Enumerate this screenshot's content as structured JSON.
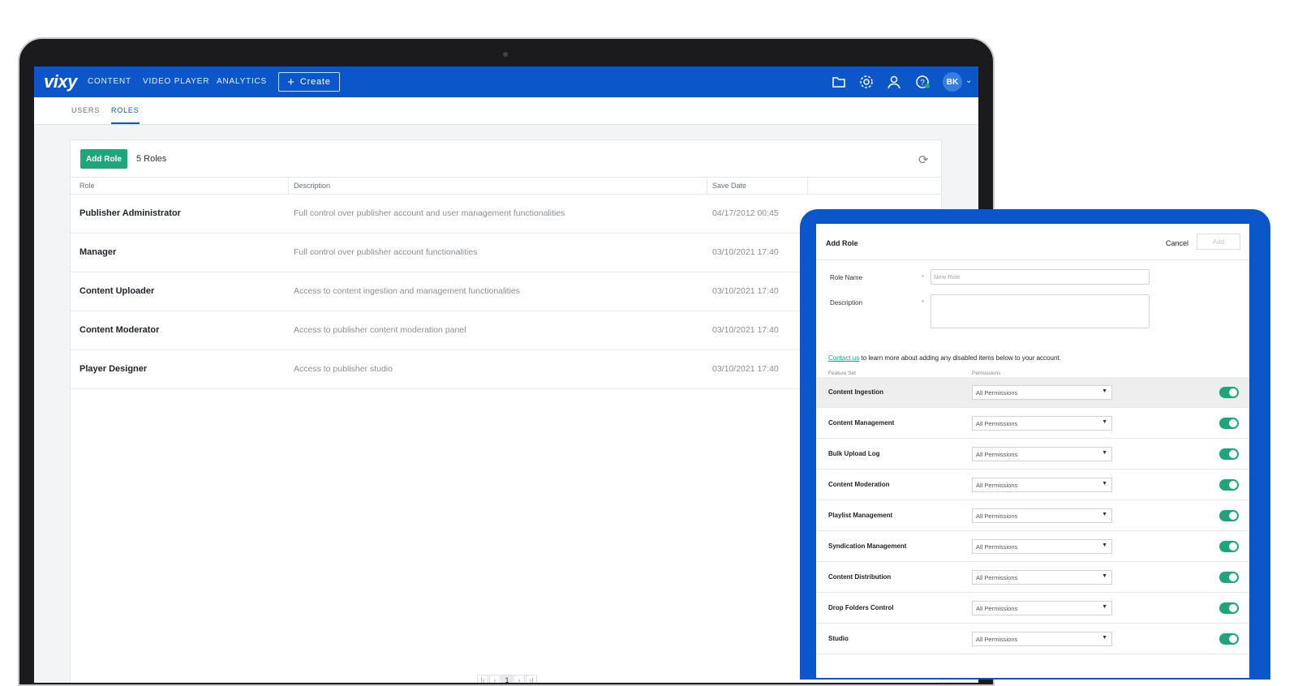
{
  "app": {
    "logo": "vixy",
    "nav": [
      "CONTENT",
      "VIDEO PLAYER",
      "ANALYTICS"
    ],
    "create_label": "Create",
    "avatar_initials": "BK",
    "icons": [
      "folder-icon",
      "gear-icon",
      "user-icon",
      "help-icon"
    ],
    "accent": "#0b56c9",
    "success": "#1ea57a"
  },
  "subtabs": [
    "USERS",
    "ROLES"
  ],
  "roles_panel": {
    "add_role_label": "Add Role",
    "count_label": "5 Roles",
    "columns": [
      "Role",
      "Description",
      "Save Date"
    ],
    "rows": [
      {
        "name": "Publisher Administrator",
        "description": "Full control over publisher account and user management functionalities",
        "date": "04/17/2012 00:45"
      },
      {
        "name": "Manager",
        "description": "Full control over publisher account functionalities",
        "date": "03/10/2021 17:40"
      },
      {
        "name": "Content Uploader",
        "description": "Access to content ingestion and management functionalities",
        "date": "03/10/2021 17:40"
      },
      {
        "name": "Content Moderator",
        "description": "Access to publisher content moderation panel",
        "date": "03/10/2021 17:40"
      },
      {
        "name": "Player Designer",
        "description": "Access to publisher studio",
        "date": "03/10/2021 17:40"
      }
    ],
    "pager": {
      "current_page": "1"
    }
  },
  "add_role_form": {
    "title": "Add Role",
    "cancel_label": "Cancel",
    "add_label": "Add",
    "role_name_label": "Role Name",
    "role_name_placeholder": "New Role",
    "description_label": "Description",
    "required_mark": "*",
    "contact_link": "Contact us",
    "contact_text": " to learn more about adding any disabled items below to your account.",
    "feature_set_header": "Feature Set",
    "permissions_header": "Permissions",
    "features": [
      {
        "name": "Content Ingestion",
        "permission": "All Permissions",
        "enabled": true
      },
      {
        "name": "Content Management",
        "permission": "All Permissions",
        "enabled": true
      },
      {
        "name": "Bulk Upload Log",
        "permission": "All Permissions",
        "enabled": true
      },
      {
        "name": "Content Moderation",
        "permission": "All Permissions",
        "enabled": true
      },
      {
        "name": "Playlist Management",
        "permission": "All Permissions",
        "enabled": true
      },
      {
        "name": "Syndication Management",
        "permission": "All Permissions",
        "enabled": true
      },
      {
        "name": "Content Distribution",
        "permission": "All Permissions",
        "enabled": true
      },
      {
        "name": "Drop Folders Control",
        "permission": "All Permissions",
        "enabled": true
      },
      {
        "name": "Studio",
        "permission": "All Permissions",
        "enabled": true
      }
    ]
  }
}
